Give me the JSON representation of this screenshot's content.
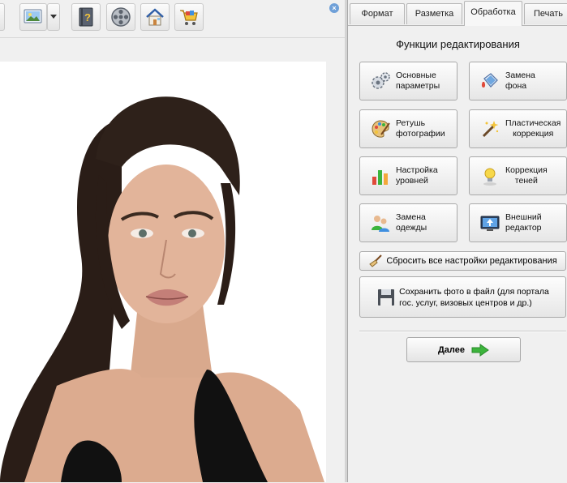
{
  "tabs": [
    {
      "label": "Формат"
    },
    {
      "label": "Разметка"
    },
    {
      "label": "Обработка"
    },
    {
      "label": "Печать"
    }
  ],
  "active_tab": "Обработка",
  "panel": {
    "title": "Функции редактирования",
    "buttons": [
      {
        "line1": "Основные",
        "line2": "параметры",
        "icon": "gears-icon"
      },
      {
        "line1": "Замена",
        "line2": "фона",
        "icon": "paint-bucket-icon"
      },
      {
        "line1": "Ретушь",
        "line2": "фотографии",
        "icon": "palette-icon"
      },
      {
        "line1": "Пластическая",
        "line2": "коррекция",
        "icon": "magic-wand-icon"
      },
      {
        "line1": "Настройка",
        "line2": "уровней",
        "icon": "bar-levels-icon"
      },
      {
        "line1": "Коррекция",
        "line2": "теней",
        "icon": "lamp-icon"
      },
      {
        "line1": "Замена",
        "line2": "одежды",
        "icon": "people-icon"
      },
      {
        "line1": "Внешний",
        "line2": "редактор",
        "icon": "monitor-icon"
      }
    ],
    "reset_label": "Сбросить все настройки редактирования",
    "save_line1": "Сохранить фото в файл (для портала",
    "save_line2": "гос. услуг, визовых центров и др.)",
    "next_label": "Далее"
  },
  "toolbar": {
    "icons": [
      "image-dropdown-icon",
      "help-book-icon",
      "film-reel-icon",
      "home-icon",
      "cart-icon"
    ]
  },
  "colors": {
    "accent": "#6fa0d8",
    "green_arrow": "#3cb43c"
  }
}
